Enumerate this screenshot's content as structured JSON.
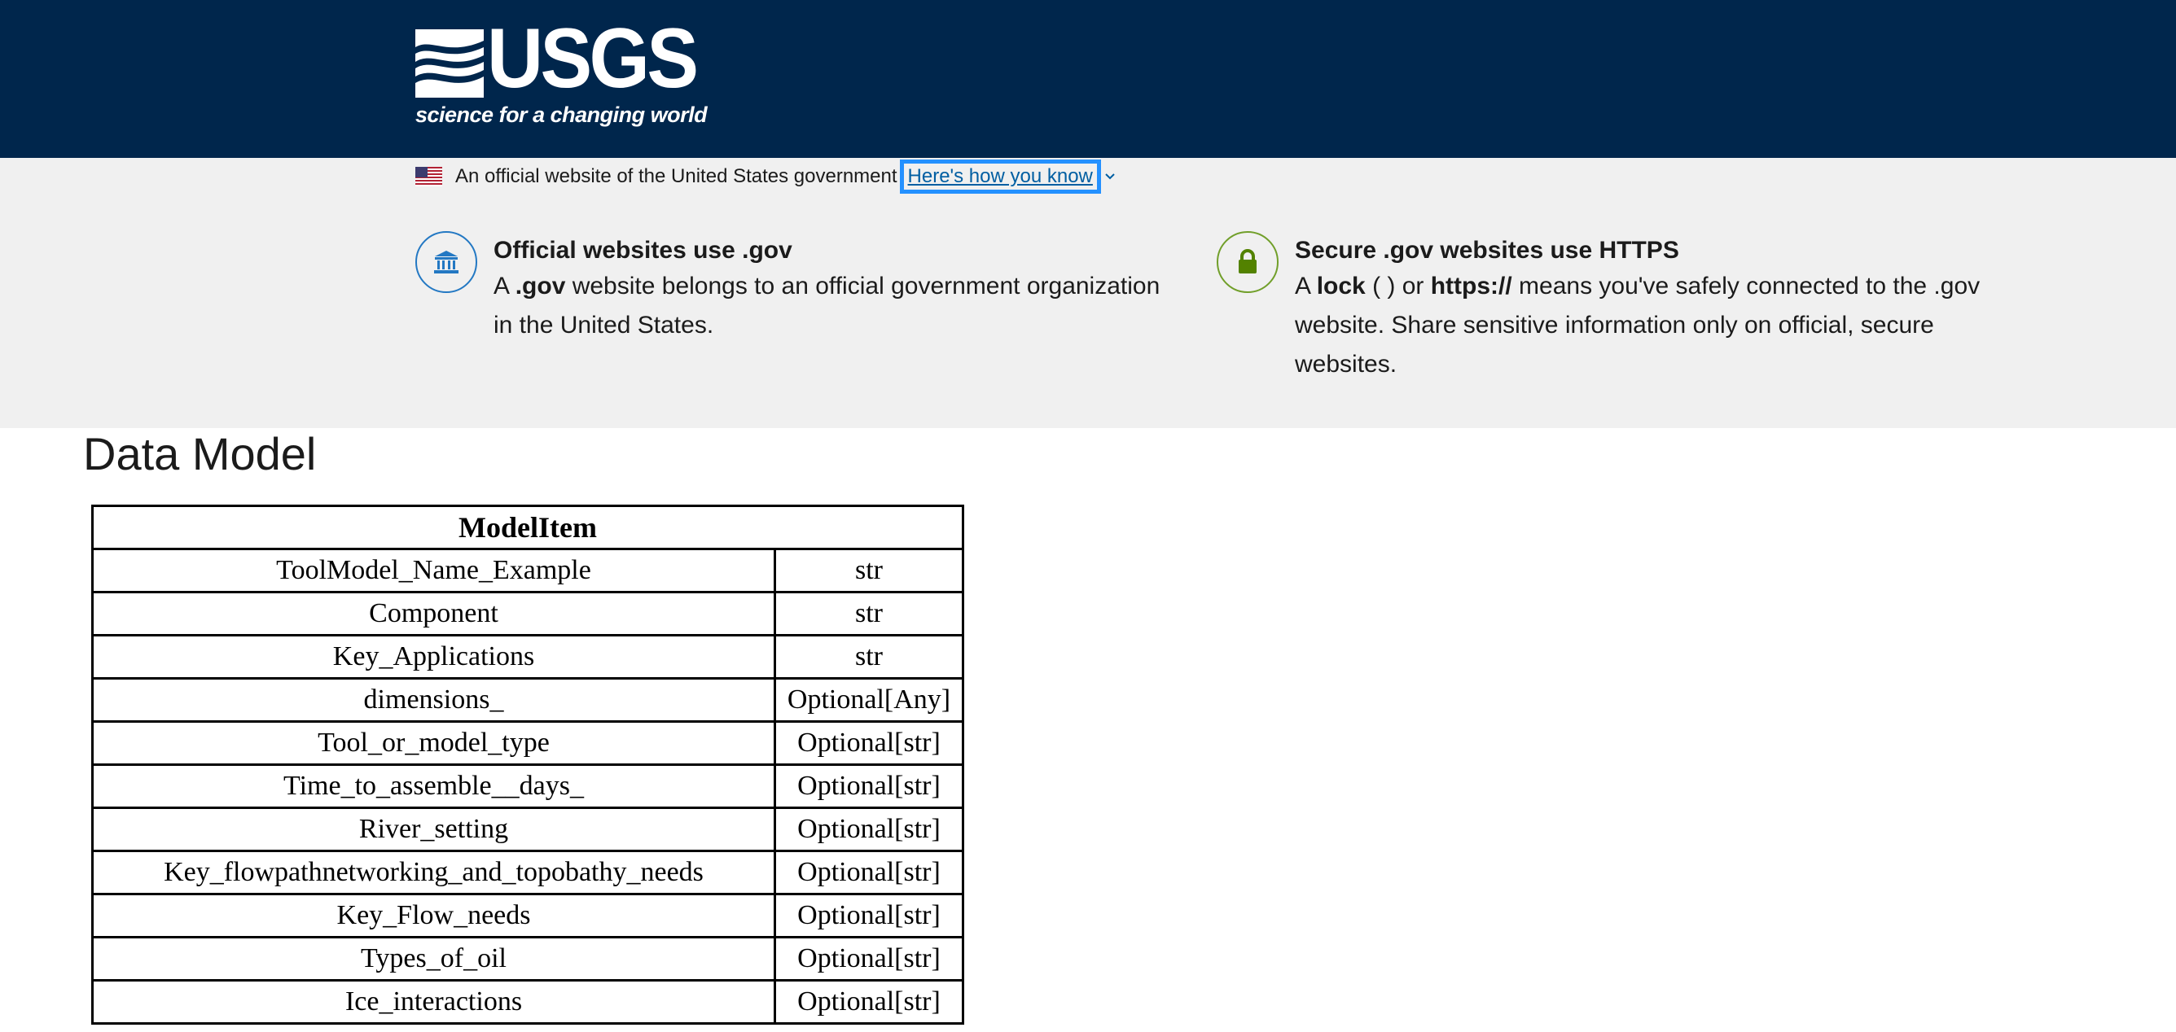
{
  "header": {
    "logo_text": "USGS",
    "tagline": "science for a changing world"
  },
  "gov_banner": {
    "official_text": "An official website of the United States government",
    "how_you_know_link": "Here's how you know",
    "dot_gov": {
      "title": "Official websites use .gov",
      "body_prefix": "A ",
      "body_bold": ".gov",
      "body_suffix": " website belongs to an official government organization in the United States."
    },
    "https": {
      "title": "Secure .gov websites use HTTPS",
      "body_prefix": "A ",
      "body_bold1": "lock",
      "body_middle": " ( ) or ",
      "body_bold2": "https://",
      "body_suffix": " means you've safely connected to the .gov website. Share sensitive information only on official, secure websites."
    },
    "colors": {
      "header_bg": "#00264c",
      "banner_bg": "#f0f0f0",
      "link": "#005ea2",
      "focus": "#2491ff",
      "lock_green": "#538200"
    }
  },
  "main": {
    "title": "Data Model",
    "table": {
      "header": "ModelItem",
      "rows": [
        {
          "name": "ToolModel_Name_Example",
          "type": "str"
        },
        {
          "name": "Component",
          "type": "str"
        },
        {
          "name": "Key_Applications",
          "type": "str"
        },
        {
          "name": "dimensions_",
          "type": "Optional[Any]"
        },
        {
          "name": "Tool_or_model_type",
          "type": "Optional[str]"
        },
        {
          "name": "Time_to_assemble__days_",
          "type": "Optional[str]"
        },
        {
          "name": "River_setting",
          "type": "Optional[str]"
        },
        {
          "name": "Key_flowpathnetworking_and_topobathy_needs",
          "type": "Optional[str]"
        },
        {
          "name": "Key_Flow_needs",
          "type": "Optional[str]"
        },
        {
          "name": "Types_of_oil",
          "type": "Optional[str]"
        },
        {
          "name": "Ice_interactions",
          "type": "Optional[str]"
        }
      ]
    }
  }
}
